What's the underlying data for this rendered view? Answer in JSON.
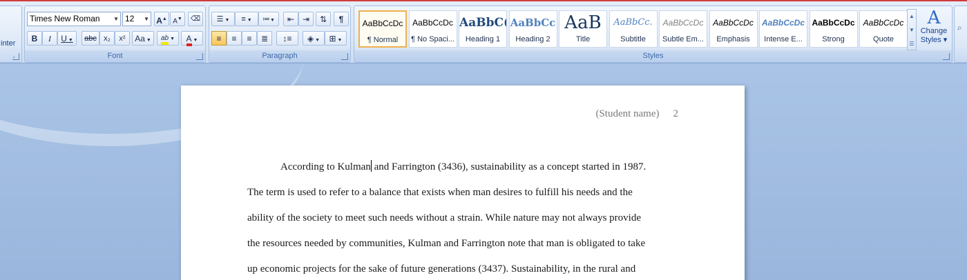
{
  "clipboard": {
    "format_painter_label": "inter"
  },
  "font": {
    "group_label": "Font",
    "font_name": "Times New Roman",
    "font_size": "12",
    "grow_glyph": "A",
    "shrink_glyph": "A",
    "bold": "B",
    "italic": "I",
    "underline": "U",
    "strike": "abc",
    "subscript": "x₂",
    "superscript": "x²",
    "change_case": "Aa",
    "highlight": "ab",
    "font_color": "A",
    "highlight_color": "#f5e600",
    "font_color_value": "#e02020"
  },
  "paragraph": {
    "group_label": "Paragraph",
    "pilcrow": "¶"
  },
  "styles": {
    "group_label": "Styles",
    "items": [
      {
        "sample": "AaBbCcDc",
        "name": "¶ Normal"
      },
      {
        "sample": "AaBbCcDc",
        "name": "¶ No Spaci..."
      },
      {
        "sample": "AaBbC(",
        "name": "Heading 1"
      },
      {
        "sample": "AaBbCc",
        "name": "Heading 2"
      },
      {
        "sample": "AaB",
        "name": "Title"
      },
      {
        "sample": "AaBbCc.",
        "name": "Subtitle"
      },
      {
        "sample": "AaBbCcDc",
        "name": "Subtle Em..."
      },
      {
        "sample": "AaBbCcDc",
        "name": "Emphasis"
      },
      {
        "sample": "AaBbCcDc",
        "name": "Intense E..."
      },
      {
        "sample": "AaBbCcDc",
        "name": "Strong"
      },
      {
        "sample": "AaBbCcDc",
        "name": "Quote"
      }
    ],
    "change_styles_glyph": "A",
    "change_styles_line1": "Change",
    "change_styles_line2": "Styles ▾"
  },
  "document": {
    "header_name": "(Student name)",
    "page_number": "2",
    "line1_before_cursor": "According to Kulman",
    "line1_after_cursor": " and Farrington (3436), sustainability as a concept started in 1987.",
    "line2": "The term is used to refer to a balance that exists when man desires to fulfill his needs and the",
    "line3": "ability of the society to meet such needs without a strain. While nature may not always provide",
    "line4": "the resources needed by communities, Kulman and Farrington note that man is obligated to take",
    "line5": "up economic projects for the sake of future generations (3437). Sustainability, in the rural and"
  }
}
